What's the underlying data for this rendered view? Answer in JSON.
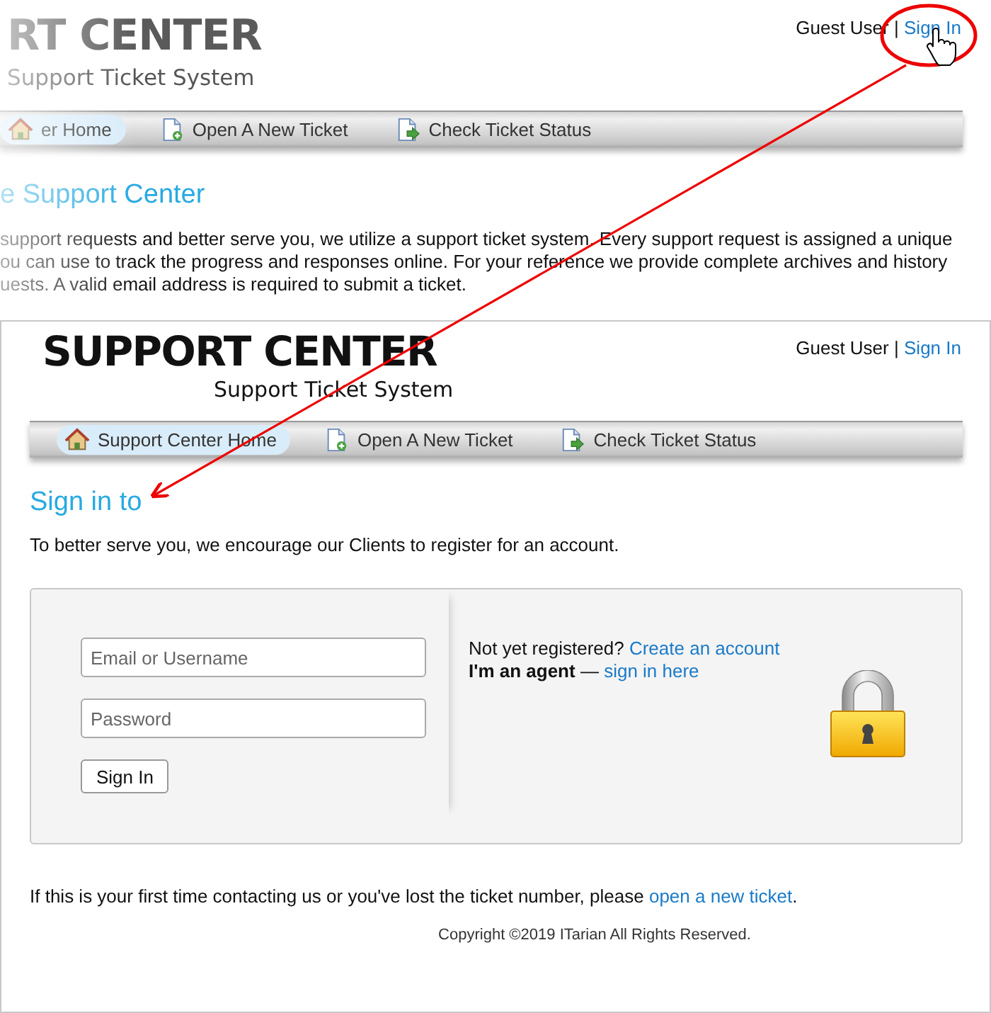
{
  "excerpt": {
    "logo_title": "RT CENTER",
    "logo_subtitle": "Support Ticket System",
    "user": "Guest User",
    "separator": "|",
    "sign_in": "Sign In",
    "nav": [
      {
        "kind": "home",
        "label": "er Home",
        "selected": true
      },
      {
        "kind": "new",
        "label": "Open A New Ticket",
        "selected": false
      },
      {
        "kind": "status",
        "label": "Check Ticket Status",
        "selected": false
      }
    ],
    "heading": "e Support Center",
    "paragraph_lines": [
      "support requests and better serve you, we utilize a support ticket system. Every support request is assigned a unique",
      "ou can use to track the progress and responses online. For your reference we provide complete archives and history",
      "uests. A valid email address is required to submit a ticket."
    ]
  },
  "page": {
    "logo_title": "SUPPORT CENTER",
    "logo_subtitle": "Support Ticket System",
    "user": "Guest User",
    "separator": "|",
    "sign_in": "Sign In",
    "nav": [
      {
        "kind": "home",
        "label": "Support Center Home",
        "selected": true
      },
      {
        "kind": "new",
        "label": "Open A New Ticket",
        "selected": false
      },
      {
        "kind": "status",
        "label": "Check Ticket Status",
        "selected": false
      }
    ],
    "heading": "Sign in to",
    "intro": "To better serve you, we encourage our Clients to register for an account.",
    "login": {
      "username": {
        "placeholder": "Email or Username"
      },
      "password": {
        "placeholder": "Password"
      },
      "button": "Sign In",
      "register_text": "Not yet registered?",
      "register_link": "Create an account",
      "agent_text": "**I'm an agent** —",
      "agent_link": "sign in here"
    },
    "help_text": "If this is your first time contacting us or you've lost the ticket number, please",
    "help_link": "open a new ticket",
    "help_end": ".",
    "copyright": "Copyright ©2019 ITarian All Rights Reserved."
  }
}
